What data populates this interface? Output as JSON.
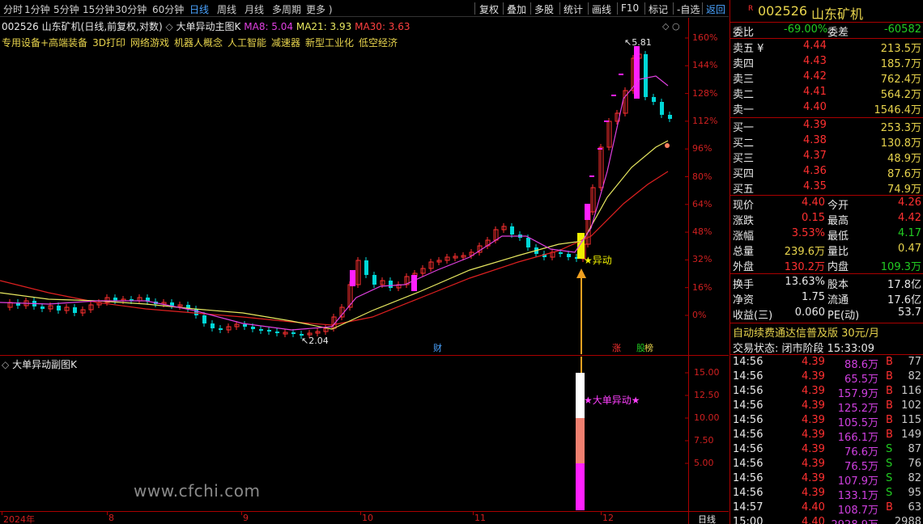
{
  "toolbar": {
    "periods": [
      "分时",
      "1分钟",
      "5分钟",
      "15分钟",
      "30分钟",
      "60分钟",
      "日线",
      "周线",
      "月线",
      "多周期",
      "更多 )"
    ],
    "active_period": "日线",
    "actions": [
      "复权",
      "叠加",
      "多股",
      "统计",
      "画线",
      "F10",
      "标记",
      "-自选",
      "返回"
    ]
  },
  "main_chart": {
    "stock_code": "002526",
    "stock_name": "山东矿机",
    "mode": "(日线,前复权,对数)",
    "indicator_name": "大单异动主图K",
    "ma8_label": "MA8: 5.04",
    "ma21_label": "MA21: 3.93",
    "ma30_label": "MA30: 3.63",
    "concepts": [
      "专用设备+高端装备",
      "3D打印",
      "网络游戏",
      "机器人概念",
      "人工智能",
      "减速器",
      "新型工业化",
      "低空经济"
    ],
    "high_marker": "5.81",
    "low_marker": "2.04",
    "signal_label": "★异动",
    "event_markers": [
      "财",
      "涨",
      "股",
      "榜"
    ],
    "axis_labels": [
      "160%",
      "144%",
      "128%",
      "112%",
      "96%",
      "80%",
      "64%",
      "48%",
      "32%",
      "16%",
      "0%"
    ]
  },
  "sub_chart": {
    "indicator_name": "大单异动副图K",
    "signal_label": "★大单异动★",
    "axis_labels": [
      "15.00",
      "12.50",
      "10.00",
      "7.50",
      "5.00"
    ]
  },
  "date_axis": {
    "labels": [
      "2024年",
      "8",
      "9",
      "10",
      "11",
      "12"
    ],
    "period_label": "日线"
  },
  "watermark": "www.cfchi.com",
  "quote_panel": {
    "badge": "R",
    "code": "002526",
    "name": "山东矿机",
    "weibi_label": "委比",
    "weibi_value": "-69.00%",
    "weicha_label": "委差",
    "weicha_value": "-60582",
    "asks": [
      {
        "label": "卖五 ¥",
        "price": "4.44",
        "volume": "213.5万"
      },
      {
        "label": "卖四",
        "price": "4.43",
        "volume": "185.7万"
      },
      {
        "label": "卖三",
        "price": "4.42",
        "volume": "762.4万"
      },
      {
        "label": "卖二",
        "price": "4.41",
        "volume": "564.2万"
      },
      {
        "label": "卖一",
        "price": "4.40",
        "volume": "1546.4万"
      }
    ],
    "bids": [
      {
        "label": "买一",
        "price": "4.39",
        "volume": "253.3万"
      },
      {
        "label": "买二",
        "price": "4.38",
        "volume": "130.8万"
      },
      {
        "label": "买三",
        "price": "4.37",
        "volume": "48.9万"
      },
      {
        "label": "买四",
        "price": "4.36",
        "volume": "87.6万"
      },
      {
        "label": "买五",
        "price": "4.35",
        "volume": "74.9万"
      }
    ],
    "stats": [
      {
        "l1": "现价",
        "v1": "4.40",
        "c1": "red",
        "l2": "今开",
        "v2": "4.26",
        "c2": "red"
      },
      {
        "l1": "涨跌",
        "v1": "0.15",
        "c1": "red",
        "l2": "最高",
        "v2": "4.42",
        "c2": "red"
      },
      {
        "l1": "涨幅",
        "v1": "3.53%",
        "c1": "red",
        "l2": "最低",
        "v2": "4.17",
        "c2": "green"
      },
      {
        "l1": "总量",
        "v1": "239.6万",
        "c1": "yellow",
        "l2": "量比",
        "v2": "0.47",
        "c2": "yellow"
      },
      {
        "l1": "外盘",
        "v1": "130.2万",
        "c1": "red",
        "l2": "内盘",
        "v2": "109.3万",
        "c2": "green"
      }
    ],
    "fundamentals": [
      {
        "l1": "换手",
        "v1": "13.63%",
        "l2": "股本",
        "v2": "17.8亿"
      },
      {
        "l1": "净资",
        "v1": "1.75",
        "l2": "流通",
        "v2": "17.6亿"
      },
      {
        "l1": "收益(三)",
        "v1": "0.060",
        "l2": "PE(动)",
        "v2": "53.7"
      }
    ],
    "promo_text": "自动续费通达信普及版  30元/月",
    "status_text": "交易状态: 闭市阶段 15:33:09",
    "ticks": [
      {
        "time": "14:56",
        "price": "4.39",
        "vol": "88.6万",
        "side": "B",
        "n": "77"
      },
      {
        "time": "14:56",
        "price": "4.39",
        "vol": "65.5万",
        "side": "B",
        "n": "82"
      },
      {
        "time": "14:56",
        "price": "4.39",
        "vol": "157.9万",
        "side": "B",
        "n": "116"
      },
      {
        "time": "14:56",
        "price": "4.39",
        "vol": "125.2万",
        "side": "B",
        "n": "102"
      },
      {
        "time": "14:56",
        "price": "4.39",
        "vol": "105.5万",
        "side": "B",
        "n": "115"
      },
      {
        "time": "14:56",
        "price": "4.39",
        "vol": "166.1万",
        "side": "B",
        "n": "149"
      },
      {
        "time": "14:56",
        "price": "4.39",
        "vol": "76.6万",
        "side": "S",
        "n": "87"
      },
      {
        "time": "14:56",
        "price": "4.39",
        "vol": "76.5万",
        "side": "S",
        "n": "76"
      },
      {
        "time": "14:56",
        "price": "4.39",
        "vol": "107.9万",
        "side": "S",
        "n": "82"
      },
      {
        "time": "14:56",
        "price": "4.39",
        "vol": "133.1万",
        "side": "S",
        "n": "95"
      },
      {
        "time": "14:57",
        "price": "4.40",
        "vol": "108.7万",
        "side": "B",
        "n": "63"
      },
      {
        "time": "15:00",
        "price": "4.40",
        "vol": "2928.9万",
        "side": "",
        "n": "2988"
      }
    ]
  },
  "colors": {
    "up": "#ff3030",
    "down": "#00d8d8",
    "ma8": "#e040e0",
    "ma21": "#e8e860",
    "ma30": "#e02020",
    "signal": "#f0f000",
    "signal_arrow": "#f0a020"
  }
}
